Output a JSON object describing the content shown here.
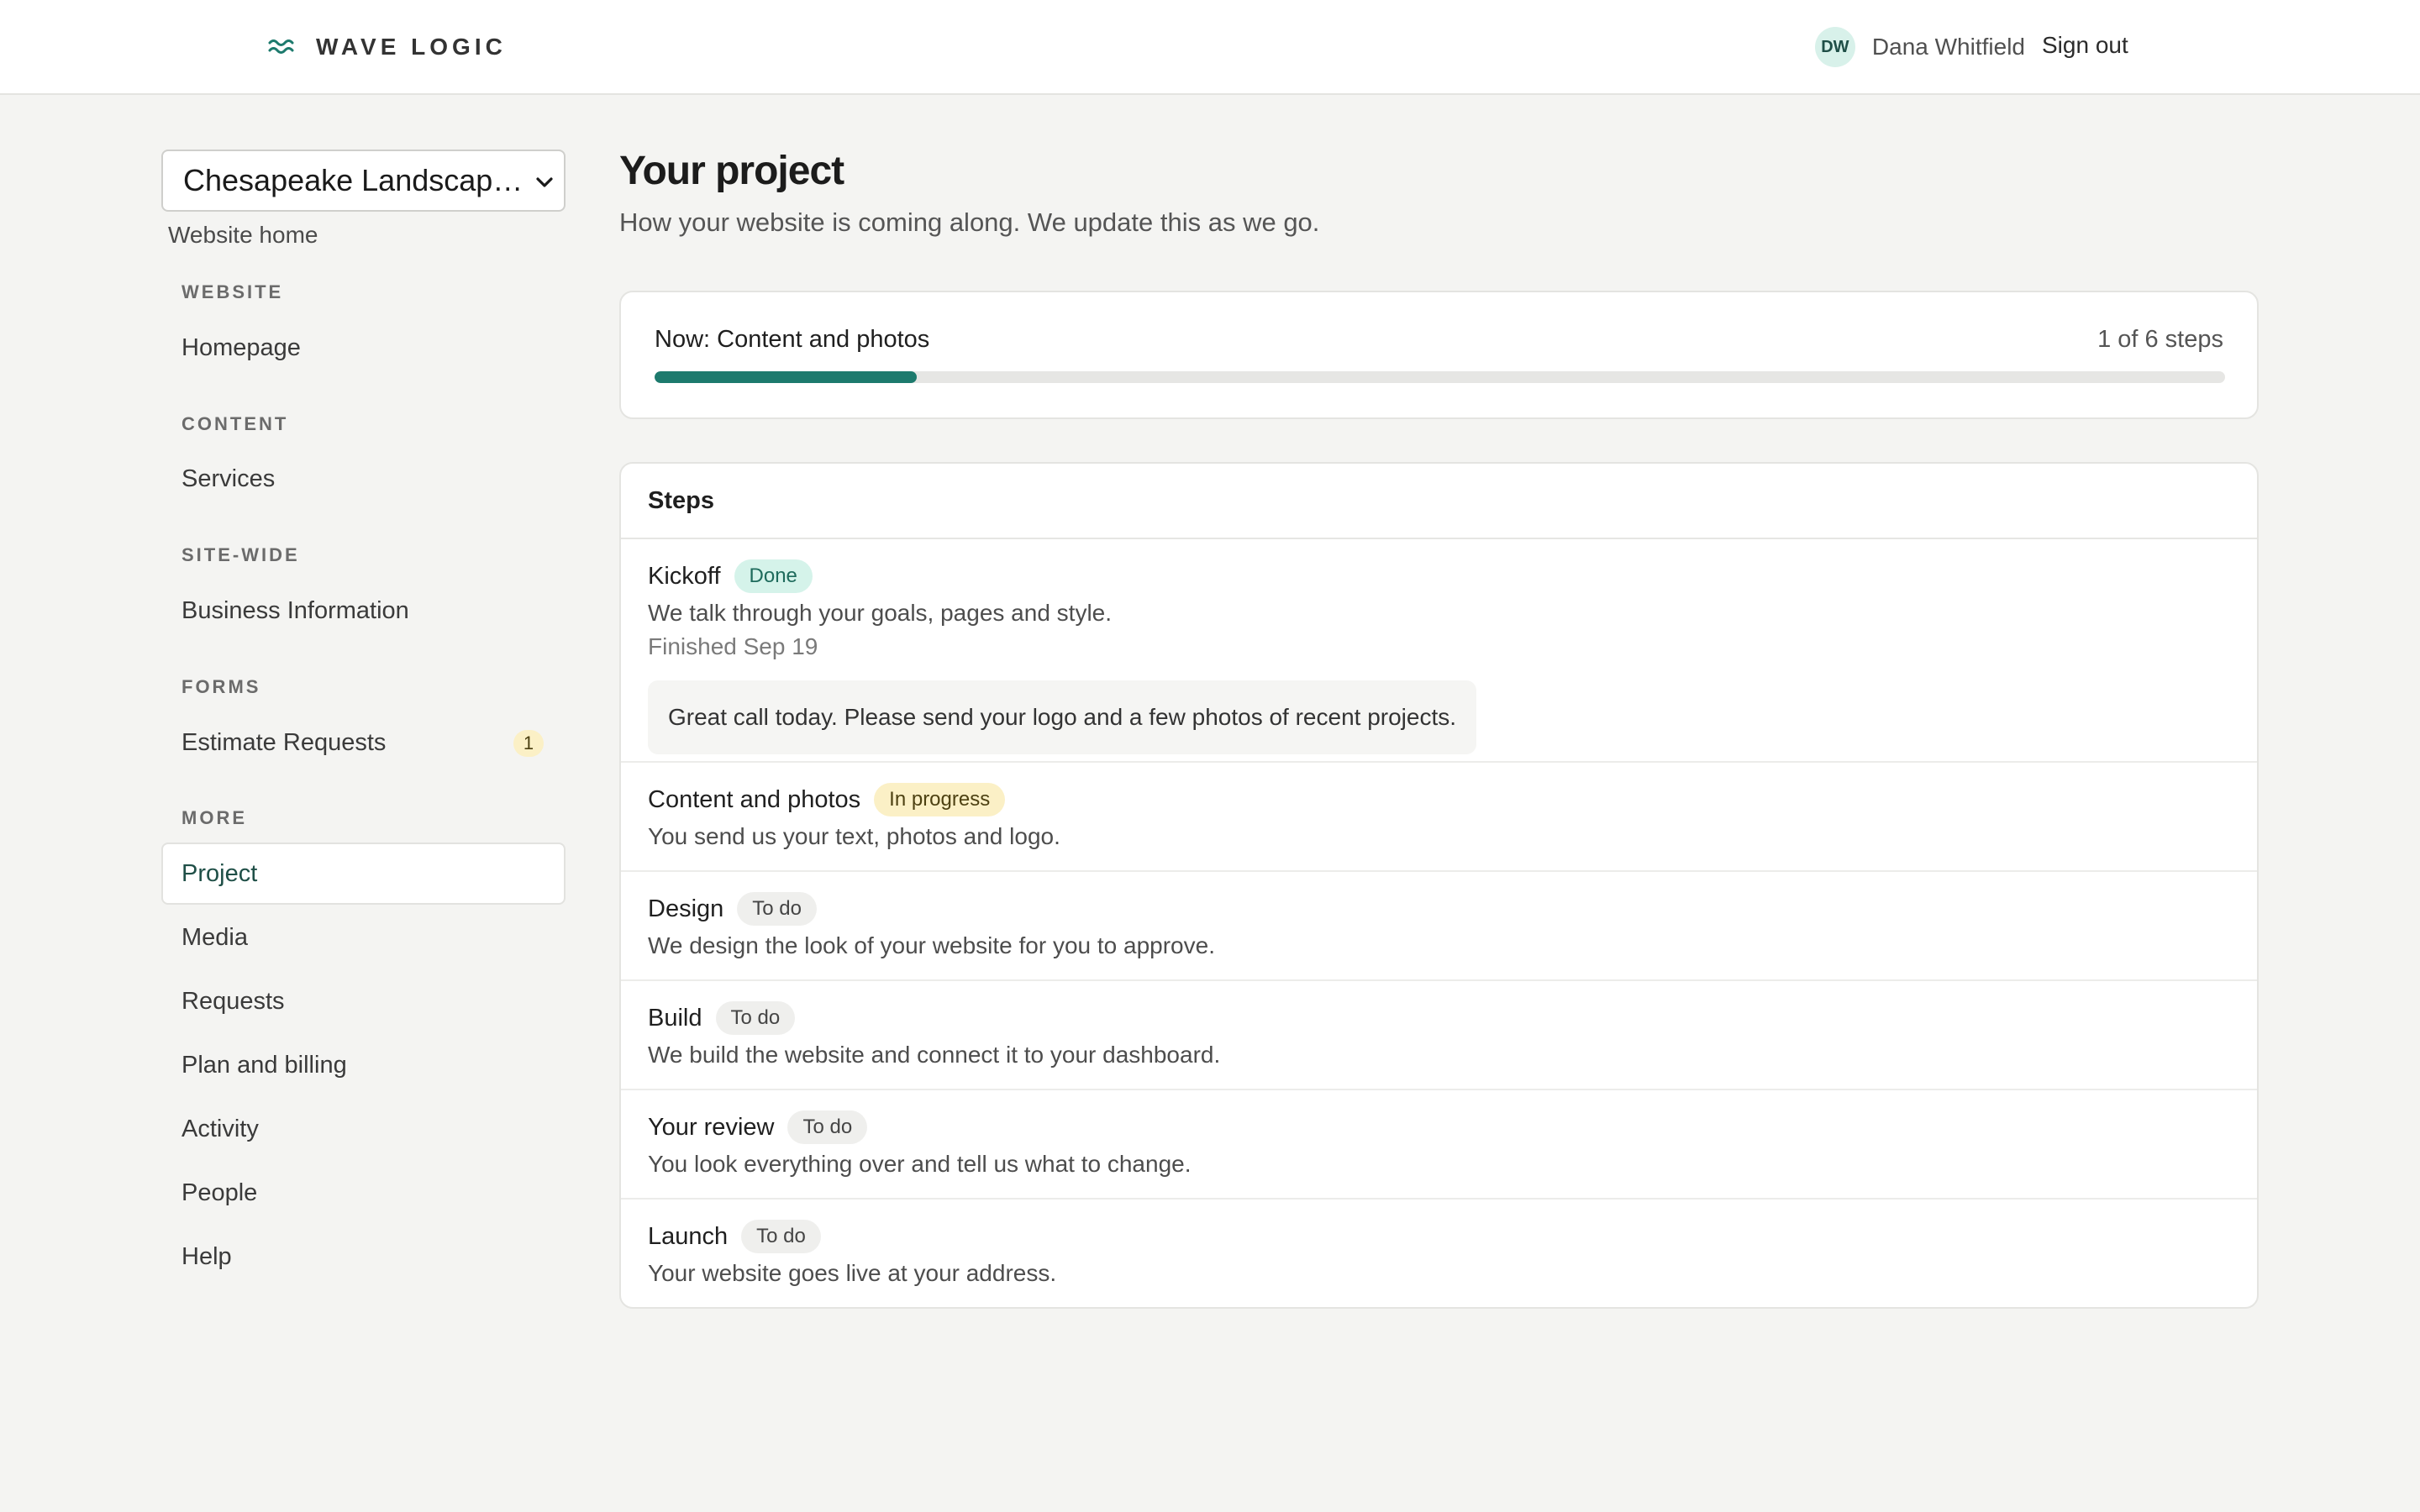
{
  "header": {
    "brand": "WAVE LOGIC",
    "brand_icon": "waves-icon",
    "user_initials": "DW",
    "user_name": "Dana Whitfield",
    "sign_out": "Sign out"
  },
  "sidebar": {
    "site_selector": "Chesapeake Landscaping",
    "home_link": "Website home",
    "sections": [
      {
        "label": "WEBSITE",
        "items": [
          "Homepage"
        ]
      },
      {
        "label": "CONTENT",
        "items": [
          "Services"
        ]
      },
      {
        "label": "SITE-WIDE",
        "items": [
          "Business Information"
        ]
      },
      {
        "label": "FORMS",
        "items": [
          "Estimate Requests"
        ]
      },
      {
        "label": "MORE",
        "items": [
          "Project",
          "Media",
          "Requests",
          "Plan and billing",
          "Activity",
          "People",
          "Help"
        ]
      }
    ],
    "estimate_requests_count": "1",
    "active_item": "Project"
  },
  "main": {
    "title": "Your project",
    "subtitle": "How your website is coming along. We update this as we go.",
    "progress": {
      "current_label": "Now: Content and photos",
      "count_label": "1 of 6 steps",
      "fraction": 0.167
    },
    "steps_title": "Steps",
    "steps": [
      {
        "name": "Kickoff",
        "status": "Done",
        "description": "We talk through your goals, pages and style.",
        "finished": "Finished Sep 19",
        "note": "Great call today. Please send your logo and a few photos of recent projects."
      },
      {
        "name": "Content and photos",
        "status": "In progress",
        "description": "You send us your text, photos and logo."
      },
      {
        "name": "Design",
        "status": "To do",
        "description": "We design the look of your website for you to approve."
      },
      {
        "name": "Build",
        "status": "To do",
        "description": "We build the website and connect it to your dashboard."
      },
      {
        "name": "Your review",
        "status": "To do",
        "description": "You look everything over and tell us what to change."
      },
      {
        "name": "Launch",
        "status": "To do",
        "description": "Your website goes live at your address."
      }
    ]
  },
  "colors": {
    "accent": "#1d7a6d",
    "done_pill": "#d5f3ea",
    "progress_pill": "#fbf0c6",
    "todo_pill": "#efefed",
    "background": "#f4f4f2"
  }
}
